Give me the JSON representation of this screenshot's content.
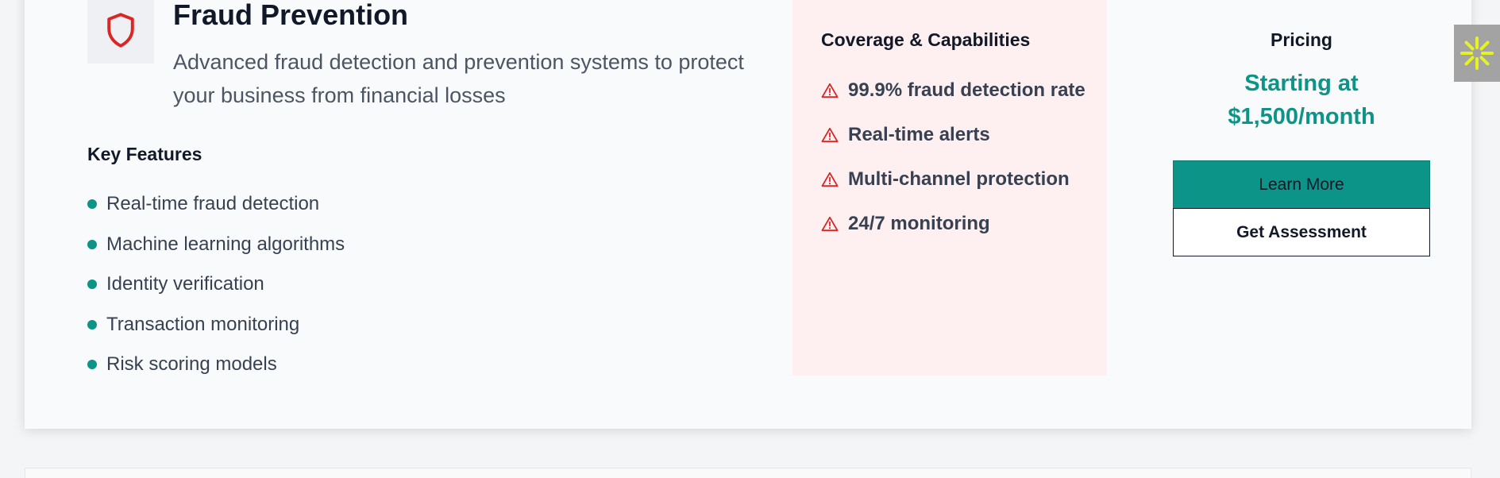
{
  "card": {
    "icon": "shield-icon",
    "title": "Fraud Prevention",
    "subtitle": "Advanced fraud detection and prevention systems to protect your business from financial losses"
  },
  "features": {
    "heading": "Key Features",
    "items": [
      "Real-time fraud detection",
      "Machine learning algorithms",
      "Identity verification",
      "Transaction monitoring",
      "Risk scoring models"
    ]
  },
  "coverage": {
    "heading": "Coverage & Capabilities",
    "icon": "warning-triangle-icon",
    "items": [
      "99.9% fraud detection rate",
      "Real-time alerts",
      "Multi-channel protection",
      "24/7 monitoring"
    ]
  },
  "pricing": {
    "label": "Pricing",
    "price": "Starting at $1,500/month",
    "learn_more": "Learn More",
    "get_assessment": "Get Assessment"
  },
  "widget": {
    "icon": "sparkle-icon"
  },
  "colors": {
    "accent": "#0d9488",
    "danger": "#dc2626",
    "coverage_bg": "#fef0f0",
    "widget_icon": "#e6f321"
  }
}
